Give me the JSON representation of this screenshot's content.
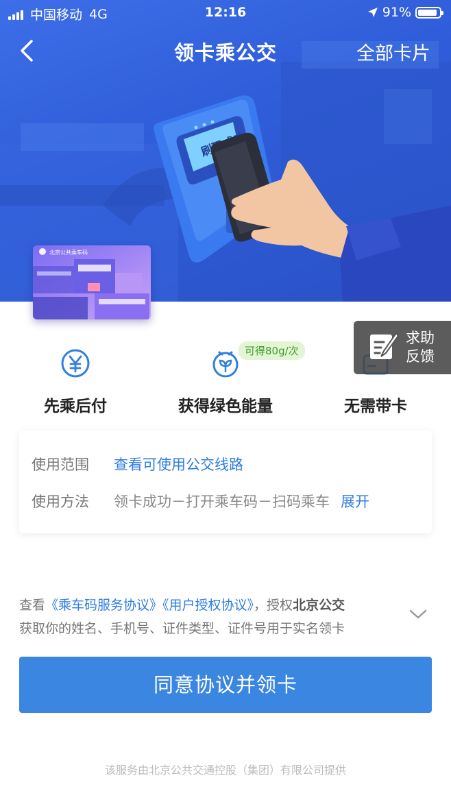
{
  "status_bar": {
    "carrier": "中国移动",
    "network": "4G",
    "time": "12:16",
    "battery": "91%",
    "battery_level": 0.91
  },
  "nav": {
    "title": "领卡乘公交",
    "right_label": "全部卡片"
  },
  "hero": {
    "scanner_text": "刷码成功",
    "card_thumbnail_text": "北京公共乘车码"
  },
  "features": [
    {
      "label": "先乘后付",
      "icon": "yen-icon"
    },
    {
      "label": "获得绿色能量",
      "icon": "sprout-icon",
      "badge": "可得80g/次"
    },
    {
      "label": "无需带卡",
      "icon": "card-icon"
    }
  ],
  "help_button": {
    "line1": "求助",
    "line2": "反馈"
  },
  "info": {
    "scope_key": "使用范围",
    "scope_link": "查看可使用公交线路",
    "method_key": "使用方法",
    "method_value": "领卡成功－打开乘车码－扫码乘车",
    "method_expand": "展开"
  },
  "agreement": {
    "prefix": "查看",
    "link1": "《乘车码服务协议》",
    "link2": "《用户授权协议》",
    "mid": "，授权",
    "org": "北京公交",
    "line2": "获取你的姓名、手机号、证件类型、证件号用于实名领卡"
  },
  "cta_label": "同意协议并领卡",
  "footer": "该服务由北京公共交通控股（集团）有限公司提供",
  "colors": {
    "hero_blue": "#2f5cd8",
    "accent": "#3a86e0",
    "link": "#2f7ee0",
    "energy_green": "#3d9b2c"
  }
}
